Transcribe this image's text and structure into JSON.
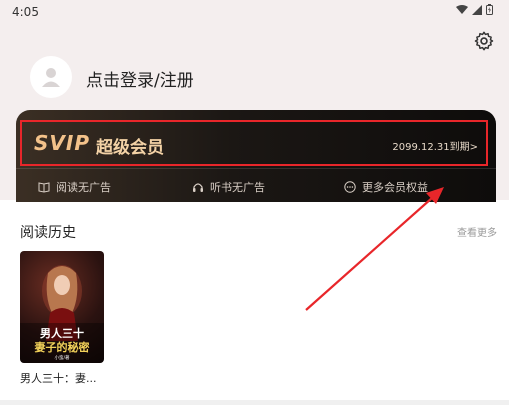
{
  "status_bar": {
    "time": "4:05"
  },
  "profile": {
    "login_text": "点击登录/注册"
  },
  "vip": {
    "badge": "SVIP",
    "title": "超级会员",
    "expire": "2099.12.31到期>",
    "benefits": [
      {
        "label": "阅读无广告",
        "icon": "book-icon"
      },
      {
        "label": "听书无广告",
        "icon": "headphones-icon"
      },
      {
        "label": "更多会员权益",
        "icon": "more-icon"
      }
    ]
  },
  "history": {
    "title": "阅读历史",
    "more": "查看更多",
    "items": [
      {
        "cover_title_line1": "男人三十",
        "cover_title_line2": "妻子的秘密",
        "cover_author": "小蛮/著",
        "name": "男人三十：妻..."
      }
    ]
  },
  "colors": {
    "header_bg": "#f4eeee",
    "vip_gold": "#f3c28a",
    "annotation_red": "#e8262a"
  }
}
